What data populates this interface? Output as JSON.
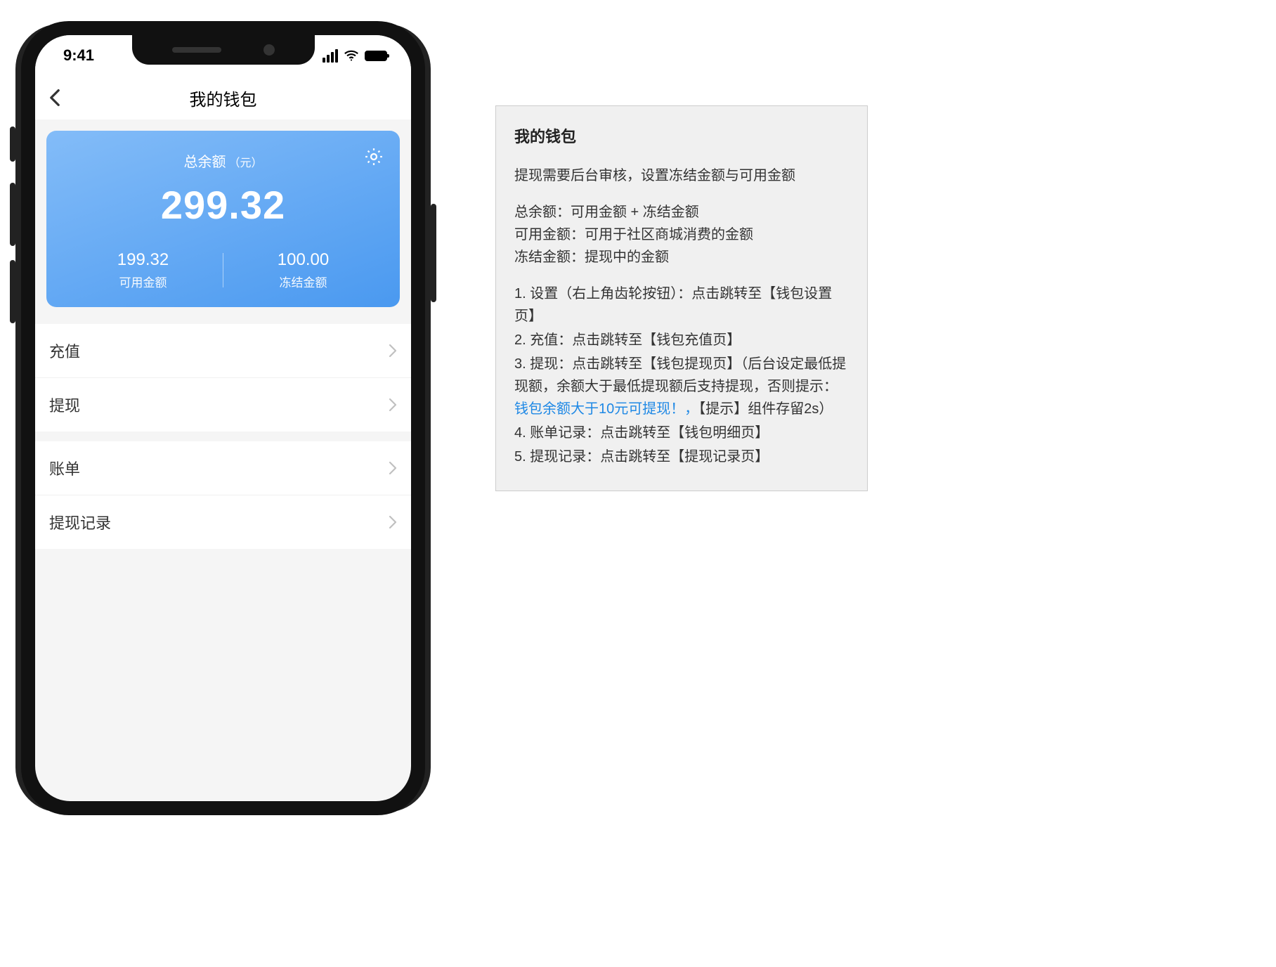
{
  "status_bar": {
    "time": "9:41"
  },
  "nav": {
    "title": "我的钱包"
  },
  "balance": {
    "total_label": "总余额",
    "total_unit": "（元）",
    "total_amount": "299.32",
    "available_amount": "199.32",
    "available_label": "可用金额",
    "frozen_amount": "100.00",
    "frozen_label": "冻结金额"
  },
  "menu": {
    "recharge": "充值",
    "withdraw": "提现",
    "bills": "账单",
    "withdraw_records": "提现记录"
  },
  "notes": {
    "title": "我的钱包",
    "intro": "提现需要后台审核，设置冻结金额与可用金额",
    "def1": "总余额：可用金额 + 冻结金额",
    "def2": "可用金额：可用于社区商城消费的金额",
    "def3": "冻结金额：提现中的金额",
    "item1": "1. 设置（右上角齿轮按钮）：点击跳转至【钱包设置页】",
    "item2": "2. 充值：点击跳转至【钱包充值页】",
    "item3a": "3. 提现：点击跳转至【钱包提现页】（后台设定最低提现额，余额大于最低提现额后支持提现，否则提示：",
    "item3b": "钱包余额大于10元可提现！，",
    "item3c": "【提示】组件存留2s）",
    "item4": "4. 账单记录：点击跳转至【钱包明细页】",
    "item5": "5. 提现记录：点击跳转至【提现记录页】"
  }
}
